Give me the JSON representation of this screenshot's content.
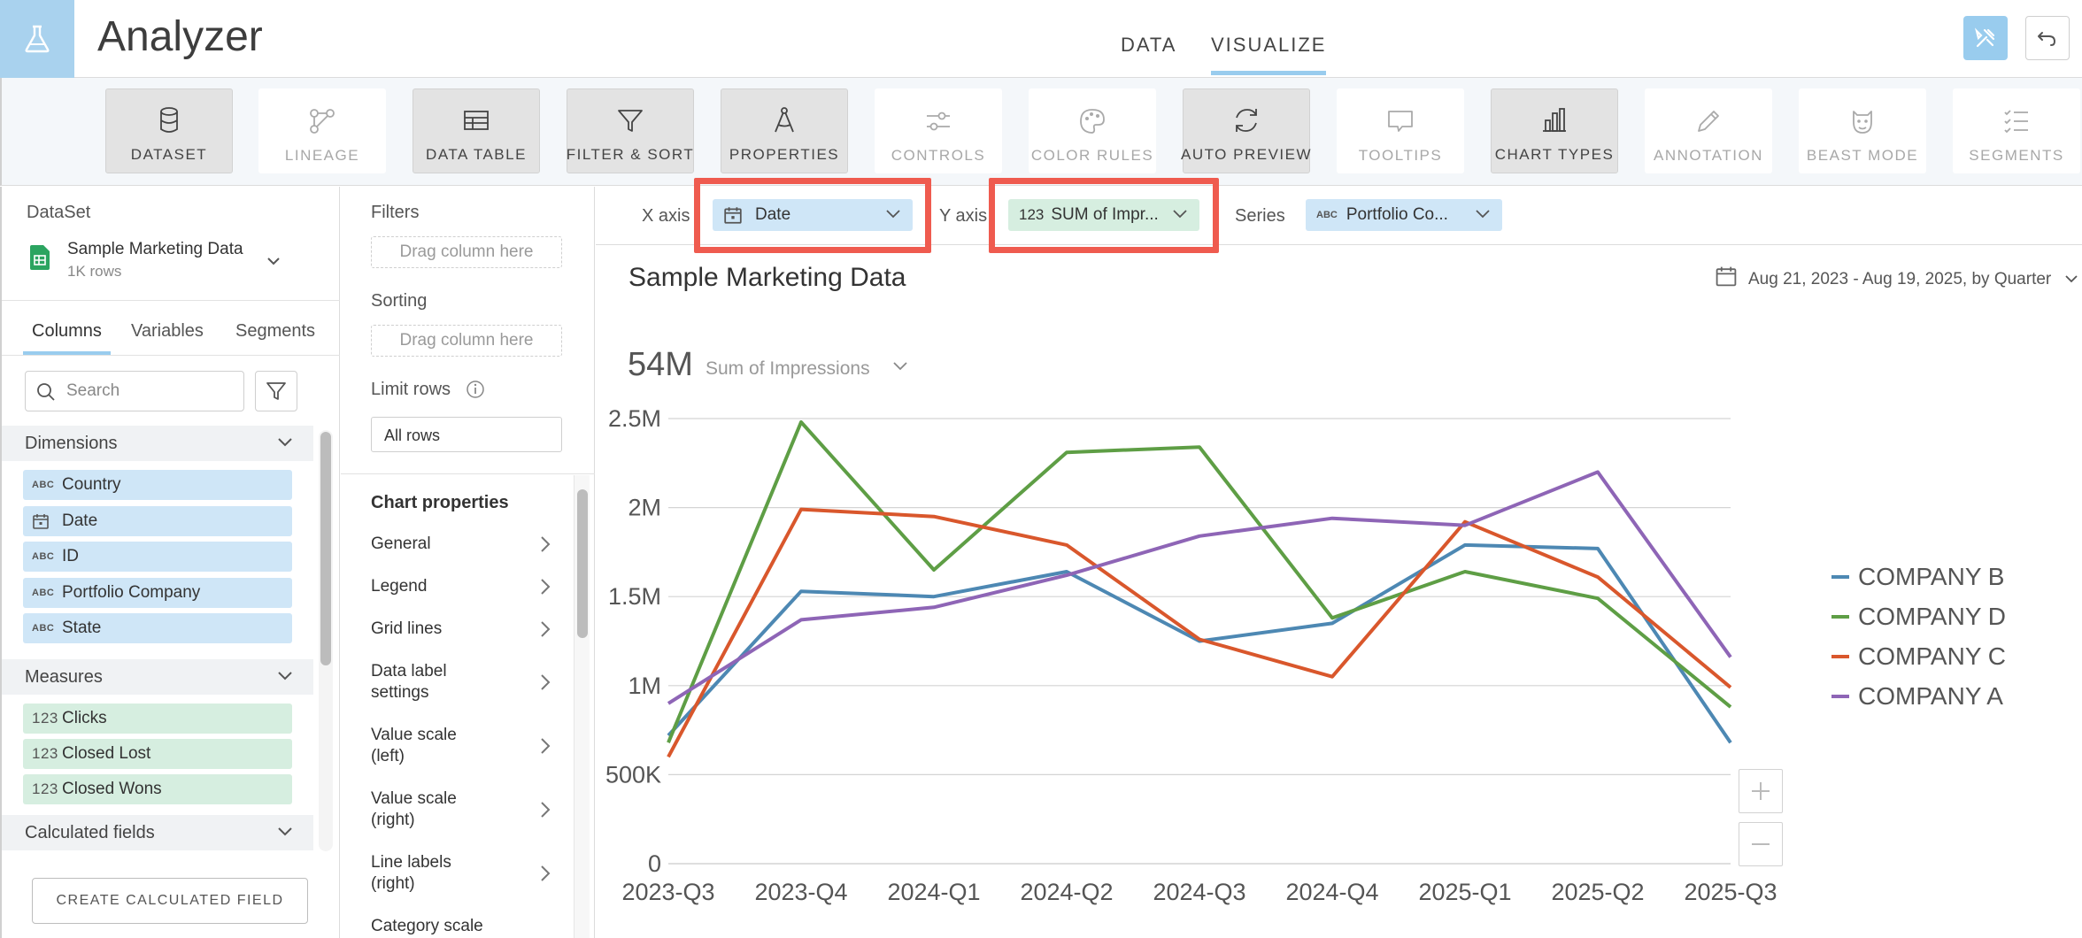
{
  "app": {
    "title": "Analyzer"
  },
  "main_tabs": [
    {
      "label": "DATA",
      "active": false
    },
    {
      "label": "VISUALIZE",
      "active": true
    }
  ],
  "colors": {
    "accent": "#99ccee",
    "dimension_bg": "#cfe6f7",
    "measure_bg": "#d6eee0",
    "highlight": "#ef5b4f"
  },
  "toolbar": {
    "items": [
      {
        "label": "DATASET",
        "icon": "database-icon",
        "enabled": true
      },
      {
        "label": "LINEAGE",
        "icon": "lineage-icon",
        "enabled": false
      },
      {
        "label": "DATA TABLE",
        "icon": "table-icon",
        "enabled": true
      },
      {
        "label": "FILTER & SORT",
        "icon": "filter-icon",
        "enabled": true
      },
      {
        "label": "PROPERTIES",
        "icon": "compass-icon",
        "enabled": true
      },
      {
        "label": "CONTROLS",
        "icon": "sliders-icon",
        "enabled": false
      },
      {
        "label": "COLOR RULES",
        "icon": "palette-icon",
        "enabled": false
      },
      {
        "label": "AUTO PREVIEW",
        "icon": "refresh-icon",
        "enabled": true
      },
      {
        "label": "TOOLTIPS",
        "icon": "tooltip-icon",
        "enabled": false
      },
      {
        "label": "CHART TYPES",
        "icon": "bar-chart-icon",
        "enabled": true
      },
      {
        "label": "ANNOTATION",
        "icon": "pencil-icon",
        "enabled": false
      },
      {
        "label": "BEAST MODE",
        "icon": "beast-icon",
        "enabled": false
      },
      {
        "label": "SEGMENTS",
        "icon": "list-check-icon",
        "enabled": false
      }
    ]
  },
  "left": {
    "heading": "DataSet",
    "dataset_name": "Sample Marketing Data",
    "dataset_rows": "1K rows",
    "tabs": [
      "Columns",
      "Variables",
      "Segments"
    ],
    "active_tab": "Columns",
    "search_placeholder": "Search",
    "dimensions_title": "Dimensions",
    "dimensions": [
      {
        "type": "ABC",
        "label": "Country"
      },
      {
        "type": "date",
        "label": "Date"
      },
      {
        "type": "ABC",
        "label": "ID"
      },
      {
        "type": "ABC",
        "label": "Portfolio Company"
      },
      {
        "type": "ABC",
        "label": "State"
      }
    ],
    "measures_title": "Measures",
    "measures": [
      {
        "type": "123",
        "label": "Clicks"
      },
      {
        "type": "123",
        "label": "Closed Lost"
      },
      {
        "type": "123",
        "label": "Closed Wons"
      }
    ],
    "calc_title": "Calculated fields",
    "calc_button": "CREATE CALCULATED FIELD"
  },
  "mid": {
    "filters_label": "Filters",
    "filters_drop": "Drag column here",
    "sorting_label": "Sorting",
    "sorting_drop": "Drag column here",
    "limit_label": "Limit rows",
    "limit_value": "All rows",
    "chart_props_title": "Chart properties",
    "props": [
      {
        "line1": "General",
        "line2": ""
      },
      {
        "line1": "Legend",
        "line2": ""
      },
      {
        "line1": "Grid lines",
        "line2": ""
      },
      {
        "line1": "Data label",
        "line2": "settings"
      },
      {
        "line1": "Value scale",
        "line2": "(left)"
      },
      {
        "line1": "Value scale",
        "line2": "(right)"
      },
      {
        "line1": "Line labels",
        "line2": "(right)"
      },
      {
        "line1": "Category scale",
        "line2": ""
      }
    ]
  },
  "axes": {
    "x_label": "X axis",
    "x_value": "Date",
    "y_label": "Y axis",
    "y_type": "123",
    "y_value": "SUM of Impr...",
    "series_label": "Series",
    "series_type": "ABC",
    "series_value": "Portfolio Co..."
  },
  "chart_header": {
    "title": "Sample Marketing Data",
    "date_range": "Aug 21, 2023 - Aug 19, 2025, by Quarter",
    "summary_value": "54M",
    "summary_metric": "Sum of Impressions"
  },
  "chart_data": {
    "type": "line",
    "title": "Sample Marketing Data",
    "categories": [
      "2023-Q3",
      "2023-Q4",
      "2024-Q1",
      "2024-Q2",
      "2024-Q3",
      "2024-Q4",
      "2025-Q1",
      "2025-Q2",
      "2025-Q3"
    ],
    "y_ticks": [
      0,
      500000,
      1000000,
      1500000,
      2000000,
      2500000
    ],
    "y_tick_labels": [
      "0",
      "500K",
      "1M",
      "1.5M",
      "2M",
      "2.5M"
    ],
    "ylim": [
      0,
      2500000
    ],
    "grid": true,
    "legend_position": "right",
    "series": [
      {
        "name": "COMPANY B",
        "color": "#4d88b3",
        "values": [
          720000,
          1530000,
          1500000,
          1640000,
          1250000,
          1350000,
          1790000,
          1770000,
          680000
        ]
      },
      {
        "name": "COMPANY D",
        "color": "#5e9e45",
        "values": [
          680000,
          2480000,
          1650000,
          2310000,
          2340000,
          1380000,
          1640000,
          1490000,
          880000
        ]
      },
      {
        "name": "COMPANY C",
        "color": "#d9572c",
        "values": [
          600000,
          1990000,
          1950000,
          1790000,
          1260000,
          1050000,
          1920000,
          1610000,
          990000
        ]
      },
      {
        "name": "COMPANY A",
        "color": "#8e65b6",
        "values": [
          900000,
          1370000,
          1440000,
          1620000,
          1840000,
          1940000,
          1900000,
          2200000,
          1160000
        ]
      }
    ]
  }
}
